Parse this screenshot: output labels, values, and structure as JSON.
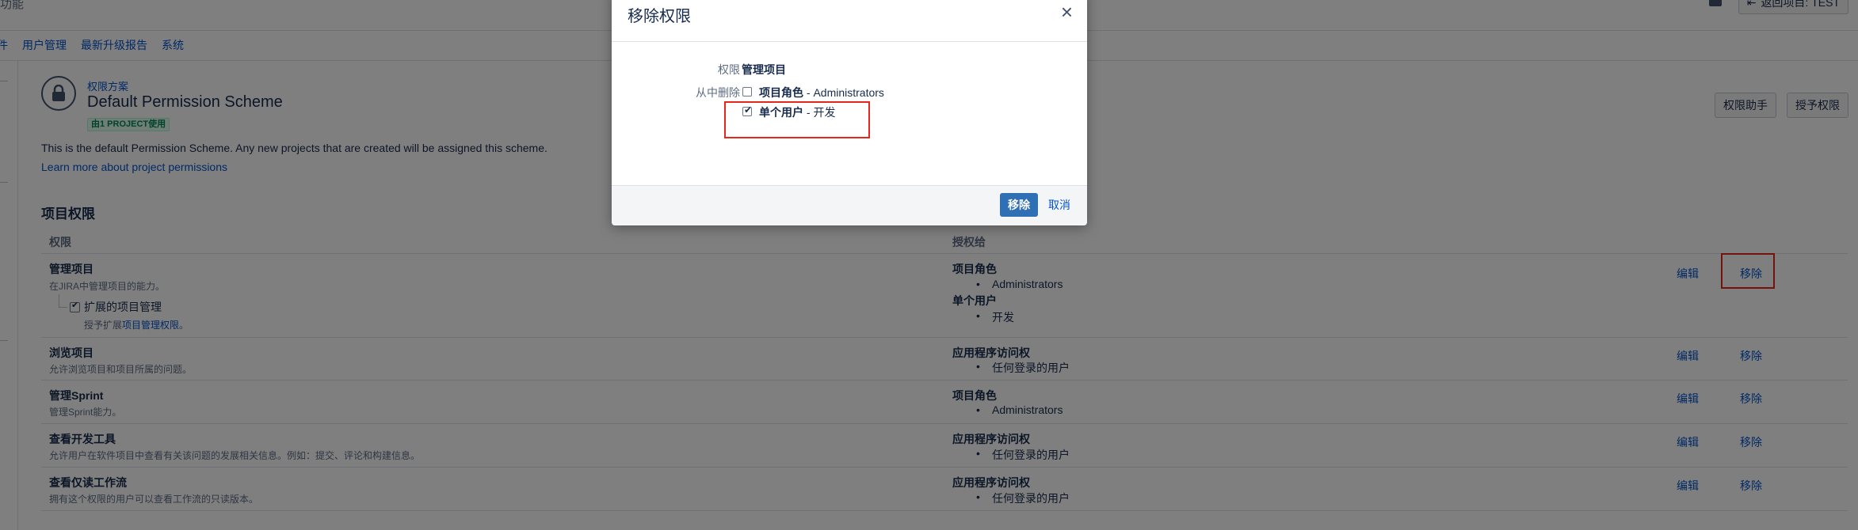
{
  "top": {
    "left_text": "功能",
    "project_button": "返回项目: TEST"
  },
  "nav": {
    "items": [
      "件",
      "用户管理",
      "最新升级报告",
      "系统"
    ]
  },
  "scheme": {
    "breadcrumb": "权限方案",
    "title": "Default Permission Scheme",
    "usage_badge": "由1 PROJECT使用",
    "description": "This is the default Permission Scheme. Any new projects that are created will be assigned this scheme.",
    "learn_more": "Learn more about project permissions",
    "help_button": "权限助手",
    "grant_button": "授予权限"
  },
  "section_title": "项目权限",
  "table": {
    "col_permission": "权限",
    "col_granted": "授权给",
    "edit_label": "编辑",
    "remove_label": "移除",
    "rows": [
      {
        "name": "管理项目",
        "desc": "在JIRA中管理项目的能力。",
        "grants": [
          {
            "type": "项目角色",
            "values": [
              "Administrators"
            ]
          },
          {
            "type": "单个用户",
            "values": [
              "开发"
            ]
          }
        ],
        "extended": {
          "label": "扩展的项目管理",
          "desc_prefix": "授予扩展",
          "desc_link": "项目管理权限",
          "desc_suffix": "。"
        }
      },
      {
        "name": "浏览项目",
        "desc": "允许浏览项目和项目所属的问题。",
        "grants": [
          {
            "type": "应用程序访问权",
            "values": [
              "任何登录的用户"
            ]
          }
        ]
      },
      {
        "name": "管理Sprint",
        "desc": "管理Sprint能力。",
        "grants": [
          {
            "type": "项目角色",
            "values": [
              "Administrators"
            ]
          }
        ]
      },
      {
        "name": "查看开发工具",
        "desc": "允许用户在软件项目中查看有关该问题的发展相关信息。例如：提交、评论和构建信息。",
        "grants": [
          {
            "type": "应用程序访问权",
            "values": [
              "任何登录的用户"
            ]
          }
        ]
      },
      {
        "name": "查看仅读工作流",
        "desc": "拥有这个权限的用户可以查看工作流的只读版本。",
        "grants": [
          {
            "type": "应用程序访问权",
            "values": [
              "任何登录的用户"
            ]
          }
        ]
      }
    ]
  },
  "dialog": {
    "title": "移除权限",
    "close": "×",
    "permission_label": "权限",
    "permission_value": "管理项目",
    "remove_from_label": "从中删除",
    "options": [
      {
        "type": "项目角色",
        "value": " - Administrators",
        "checked": false
      },
      {
        "type": "单个用户",
        "value": " - 开发",
        "checked": true
      }
    ],
    "submit": "移除",
    "cancel": "取消"
  }
}
